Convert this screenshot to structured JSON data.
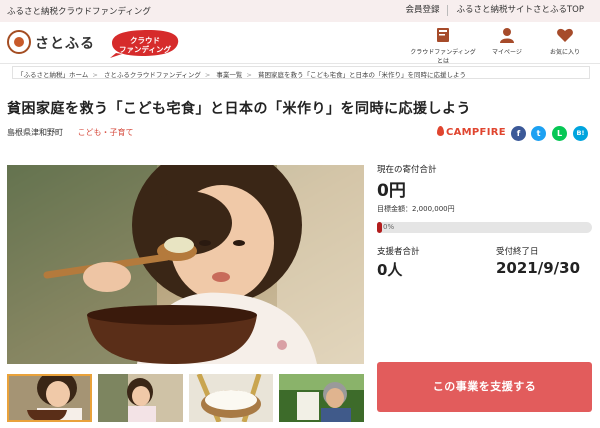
{
  "topbar": {
    "left": "ふるさと納税クラウドファンディング",
    "links": [
      "会員登録",
      "ふるさと納税サイトさとふるTOP"
    ]
  },
  "header": {
    "logo_text": "さとふる",
    "badge_line1": "クラウド",
    "badge_line2": "ファンディング",
    "nav": [
      {
        "label": "クラウドファンディングとは",
        "icon": "book-icon"
      },
      {
        "label": "マイページ",
        "icon": "person-icon"
      },
      {
        "label": "お気に入り",
        "icon": "heart-icon"
      }
    ]
  },
  "breadcrumb": [
    "「ふるさと納税」ホーム",
    "さとふるクラウドファンディング",
    "事業一覧",
    "貧困家庭を救う「こども宅食」と日本の「米作り」を同時に応援しよう"
  ],
  "project": {
    "title": "貧困家庭を救う「こども宅食」と日本の「米作り」を同時に応援しよう",
    "location": "島根県津和野町",
    "category": "こども・子育て",
    "platform": "CAMPFIRE"
  },
  "share": {
    "fb": "f",
    "tw": "t",
    "line": "L",
    "hatena": "B!"
  },
  "stats": {
    "current_label": "現在の寄付合計",
    "current_value": "0円",
    "goal_text": "目標金額：2,000,000円",
    "progress_text": "0%",
    "progress": 0.0,
    "supporters_label": "支援者合計",
    "supporters_value": "0人",
    "end_label": "受付終了日",
    "end_value": "2021/9/30"
  },
  "support_button": "この事業を支援する",
  "colors": {
    "accent": "#e25c5c",
    "brand_red": "#d64a3c",
    "progress_fill": "#b21d1d",
    "topbar_bg": "#f7eeee"
  }
}
